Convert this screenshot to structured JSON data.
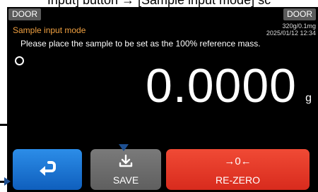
{
  "caption": "Input] button → [Sample input mode] sc",
  "header": {
    "left_button": "DOOR",
    "right_button": "DOOR",
    "mode_title": "Sample input mode",
    "capacity": "320g/0.1mg",
    "datetime": "2025/01/12  12:34"
  },
  "message": "Please place the sample to be set as the 100% reference mass.",
  "weight": {
    "value": "0.0000",
    "unit": "g"
  },
  "buttons": {
    "back_icon": "return-arrow-icon",
    "save_label": "SAVE",
    "save_icon": "save-download-icon",
    "rezero_label": "RE-ZERO",
    "rezero_symbol": "→0←"
  },
  "colors": {
    "orange": "#f0a040",
    "blue": "#1876d2",
    "gray": "#6a6a6a",
    "red": "#e33827",
    "callout": "#1d4f91"
  }
}
